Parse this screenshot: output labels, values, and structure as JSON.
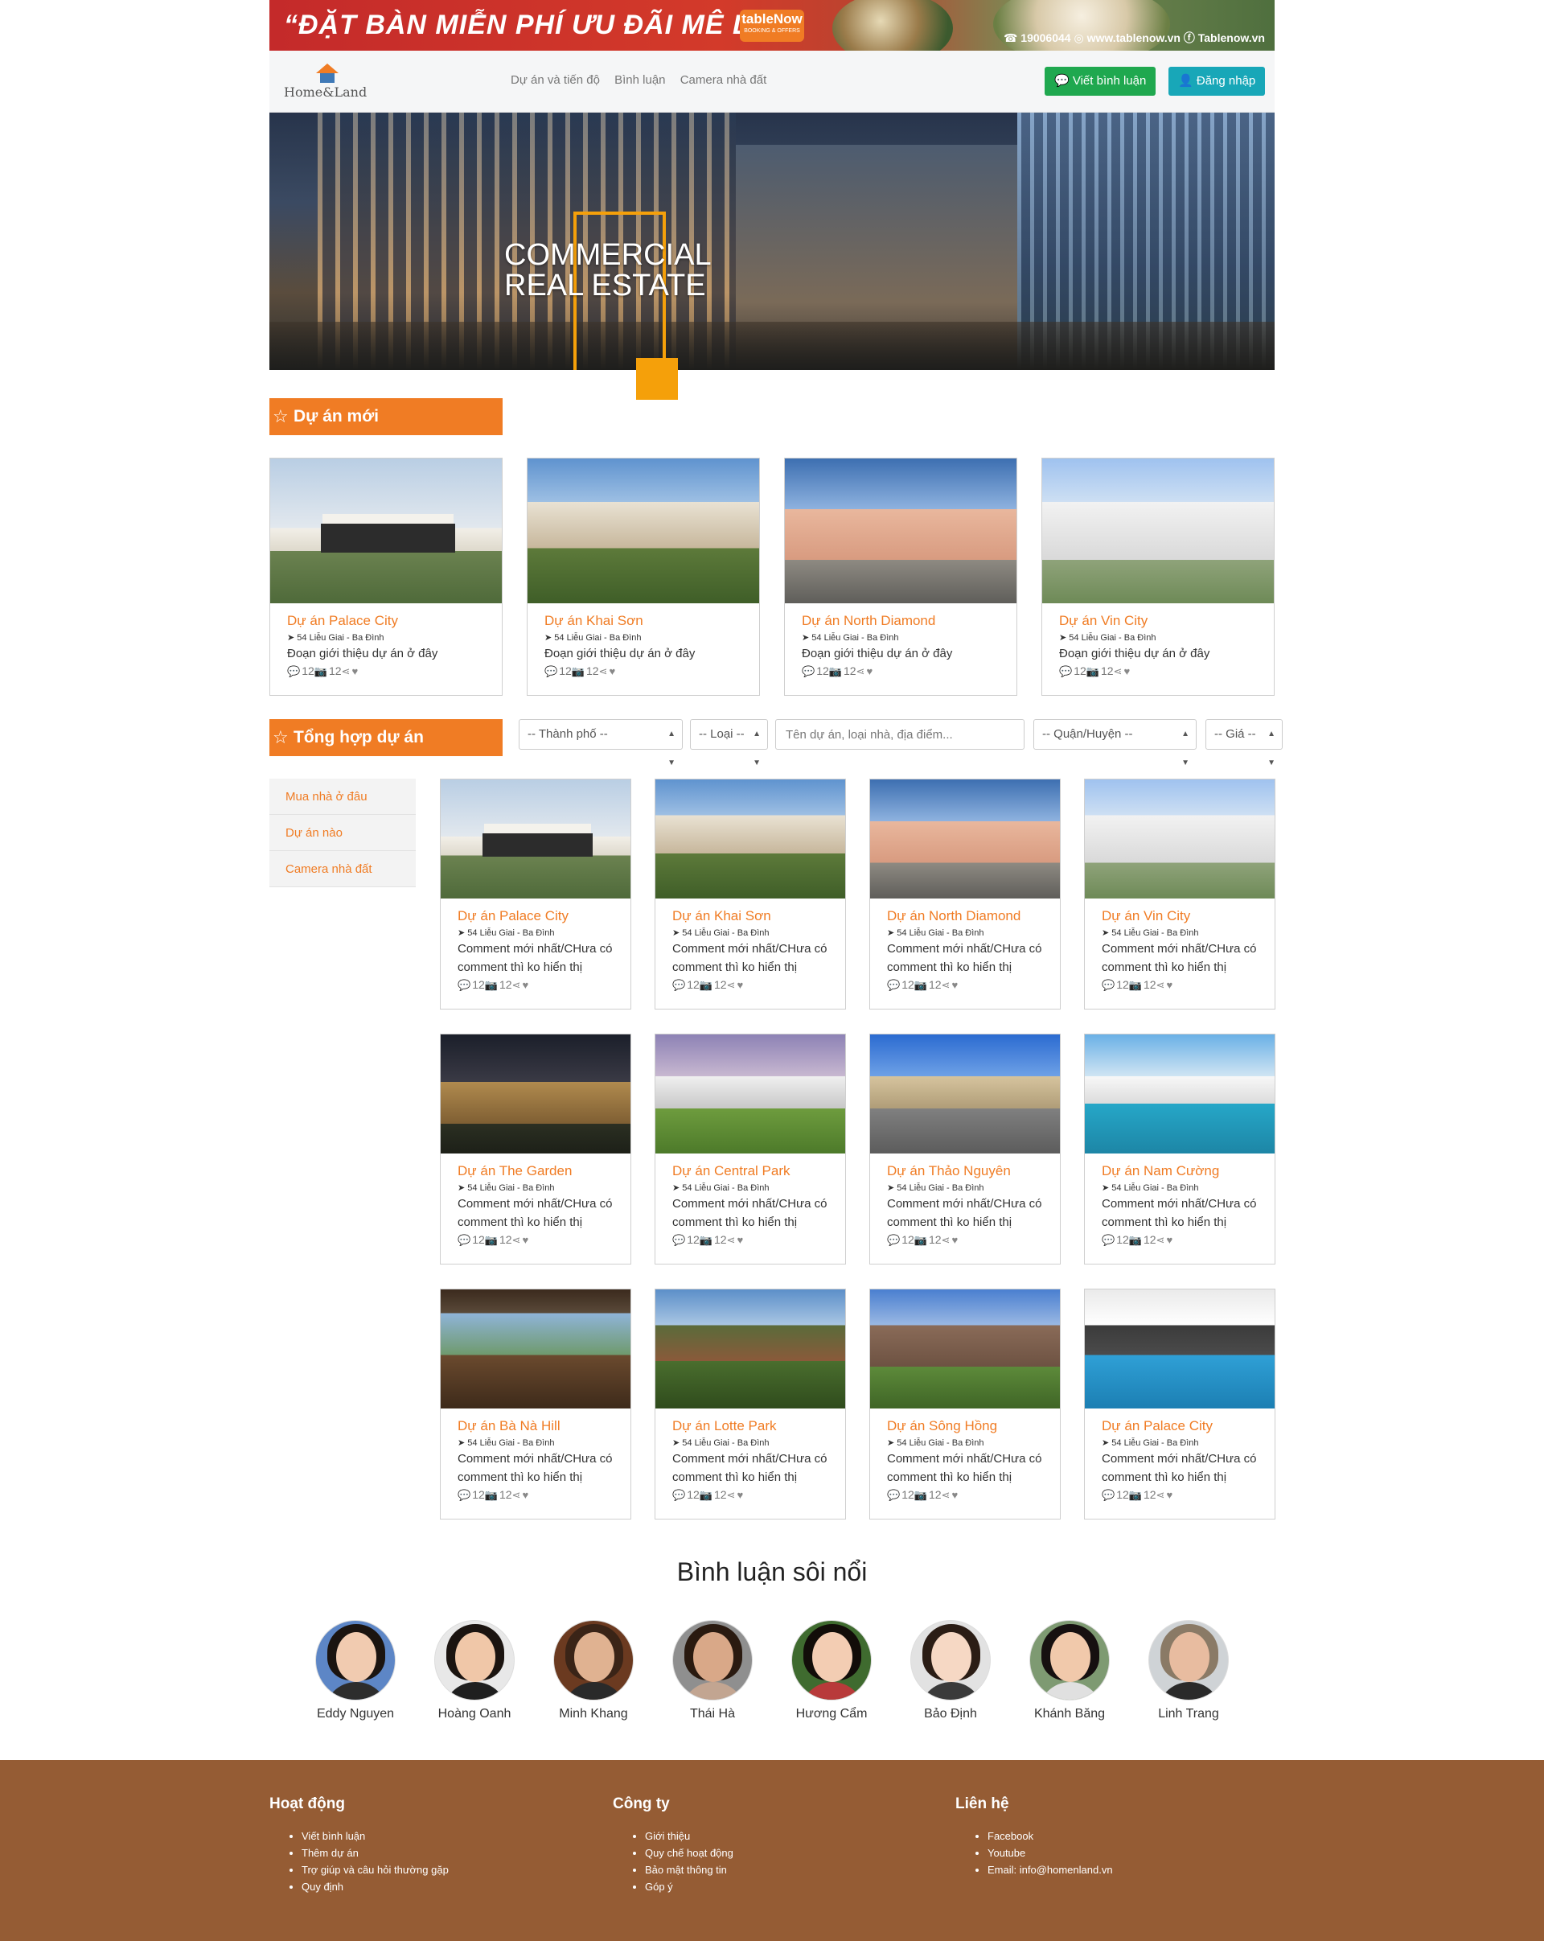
{
  "ad": {
    "headline": "“ĐẶT BÀN MIỄN PHÍ ƯU ĐÃI MÊ LY„",
    "brand": "tableNow",
    "brand_sub": "BOOKING & OFFERS",
    "contact": "☎ 19006044   ◎ www.tablenow.vn   ⓕ Tablenow.vn"
  },
  "header": {
    "logo_text": "Home&Land",
    "nav": [
      "Dự án và tiến độ",
      "Bình luận",
      "Camera nhà đất"
    ],
    "review_button": "Viết bình luận",
    "login_button": "Đăng nhập"
  },
  "hero": {
    "text": "COMMERCIAL REAL ESTATE"
  },
  "new_projects": {
    "heading": "Dự án mới",
    "items": [
      {
        "title": "Dự án Palace City",
        "address": "54 Liễu Giai - Ba Đình",
        "desc": "Đoạn giới thiệu dự án ở đây",
        "comments": "12",
        "photos": "12"
      },
      {
        "title": "Dự án Khai Sơn",
        "address": "54 Liễu Giai - Ba Đình",
        "desc": "Đoạn giới thiệu dự án ở đây",
        "comments": "12",
        "photos": "12"
      },
      {
        "title": "Dự án North Diamond",
        "address": "54 Liễu Giai - Ba Đình",
        "desc": "Đoạn giới thiệu dự án ở đây",
        "comments": "12",
        "photos": "12"
      },
      {
        "title": "Dự án Vin City",
        "address": "54 Liễu Giai - Ba Đình",
        "desc": "Đoạn giới thiệu dự án ở đây",
        "comments": "12",
        "photos": "12"
      }
    ]
  },
  "summary": {
    "heading": "Tổng hợp dự án",
    "filters": {
      "city": "-- Thành phố --",
      "type": "-- Loại --",
      "search_placeholder": "Tên dự án, loại nhà, địa điểm...",
      "district": "-- Quận/Huyện --",
      "price": "-- Giá --"
    },
    "sidebar": [
      "Mua nhà ở đâu",
      "Dự án nào",
      "Camera nhà đất"
    ],
    "items": [
      {
        "title": "Dự án Palace City",
        "address": "54 Liễu Giai - Ba Đình",
        "desc": "Comment mới nhất/CHưa có comment thì ko hiển thị",
        "comments": "12",
        "photos": "12"
      },
      {
        "title": "Dự án Khai Sơn",
        "address": "54 Liễu Giai - Ba Đình",
        "desc": "Comment mới nhất/CHưa có comment thì ko hiển thị",
        "comments": "12",
        "photos": "12"
      },
      {
        "title": "Dự án North Diamond",
        "address": "54 Liễu Giai - Ba Đình",
        "desc": "Comment mới nhất/CHưa có comment thì ko hiển thị",
        "comments": "12",
        "photos": "12"
      },
      {
        "title": "Dự án Vin City",
        "address": "54 Liễu Giai - Ba Đình",
        "desc": "Comment mới nhất/CHưa có comment thì ko hiển thị",
        "comments": "12",
        "photos": "12"
      },
      {
        "title": "Dự án The Garden",
        "address": "54 Liễu Giai - Ba Đình",
        "desc": "Comment mới nhất/CHưa có comment thì ko hiển thị",
        "comments": "12",
        "photos": "12"
      },
      {
        "title": "Dự án Central Park",
        "address": "54 Liễu Giai - Ba Đình",
        "desc": "Comment mới nhất/CHưa có comment thì ko hiển thị",
        "comments": "12",
        "photos": "12"
      },
      {
        "title": "Dự án Thảo Nguyên",
        "address": "54 Liễu Giai - Ba Đình",
        "desc": "Comment mới nhất/CHưa có comment thì ko hiển thị",
        "comments": "12",
        "photos": "12"
      },
      {
        "title": "Dự án Nam Cường",
        "address": "54 Liễu Giai - Ba Đình",
        "desc": "Comment mới nhất/CHưa có comment thì ko hiển thị",
        "comments": "12",
        "photos": "12"
      },
      {
        "title": "Dự án Bà Nà Hill",
        "address": "54 Liễu Giai - Ba Đình",
        "desc": "Comment mới nhất/CHưa có comment thì ko hiển thị",
        "comments": "12",
        "photos": "12"
      },
      {
        "title": "Dự án Lotte Park",
        "address": "54 Liễu Giai - Ba Đình",
        "desc": "Comment mới nhất/CHưa có comment thì ko hiển thị",
        "comments": "12",
        "photos": "12"
      },
      {
        "title": "Dự án Sông Hồng",
        "address": "54 Liễu Giai - Ba Đình",
        "desc": "Comment mới nhất/CHưa có comment thì ko hiển thị",
        "comments": "12",
        "photos": "12"
      },
      {
        "title": "Dự án Palace City",
        "address": "54 Liễu Giai - Ba Đình",
        "desc": "Comment mới nhất/CHưa có comment thì ko hiển thị",
        "comments": "12",
        "photos": "12"
      }
    ]
  },
  "reviewers": {
    "heading": "Bình luận sôi nổi",
    "people": [
      "Eddy Nguyen",
      "Hoàng Oanh",
      "Minh Khang",
      "Thái Hà",
      "Hương Cẩm",
      "Bảo Định",
      "Khánh Băng",
      "Linh Trang"
    ]
  },
  "footer": {
    "col1": {
      "heading": "Hoạt động",
      "links": [
        "Viết bình luận",
        "Thêm dự án",
        "Trợ giúp và câu hỏi thường gặp",
        "Quy định"
      ]
    },
    "col2": {
      "heading": "Công ty",
      "links": [
        "Giới thiệu",
        "Quy chế hoạt động",
        "Bảo mật thông tin",
        "Góp ý"
      ]
    },
    "col3": {
      "heading": "Liên hệ",
      "links": [
        "Facebook",
        "Youtube",
        "Email: info@homenland.vn"
      ]
    }
  },
  "colors": {
    "accent": "#f07c24",
    "review_button": "#1fa84f",
    "login_button": "#18a7b8",
    "footer": "#955c34"
  }
}
